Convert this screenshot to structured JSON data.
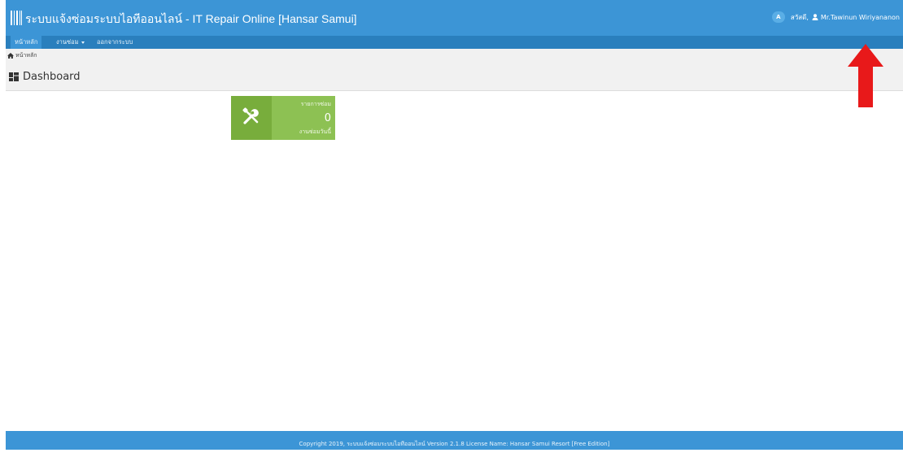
{
  "header": {
    "title": "ระบบแจ้งซ่อมระบบไอทีออนไลน์ - IT Repair Online [Hansar Samui]",
    "logo_icon": "barcode-logo-icon",
    "lang_badge": "A",
    "greeting": "สวัสดี,",
    "user_icon": "user-icon",
    "user_name": "Mr.Tawinun Wiriyananon"
  },
  "nav": {
    "home": "หน้าหลัก",
    "repair": "งานซ่อม",
    "logout": "ออกจากระบบ"
  },
  "breadcrumb": {
    "home": "หน้าหลัก",
    "icon": "home-icon"
  },
  "page": {
    "title": "Dashboard",
    "icon": "dashboard-icon"
  },
  "tile": {
    "label": "รายการซ่อม",
    "value": "0",
    "sublabel": "งานซ่อมวันนี้",
    "icon": "tools-icon",
    "color": "#8dc153"
  },
  "footer": {
    "text": "Copyright 2019, ระบบแจ้งซ่อมระบบไอทีออนไลน์ Version 2.1.8 License Name: Hansar Samui Resort [Free Edition]"
  },
  "colors": {
    "topbar": "#3c95d6",
    "navbar": "#2a7fbd",
    "annotation": "#e8191a"
  }
}
